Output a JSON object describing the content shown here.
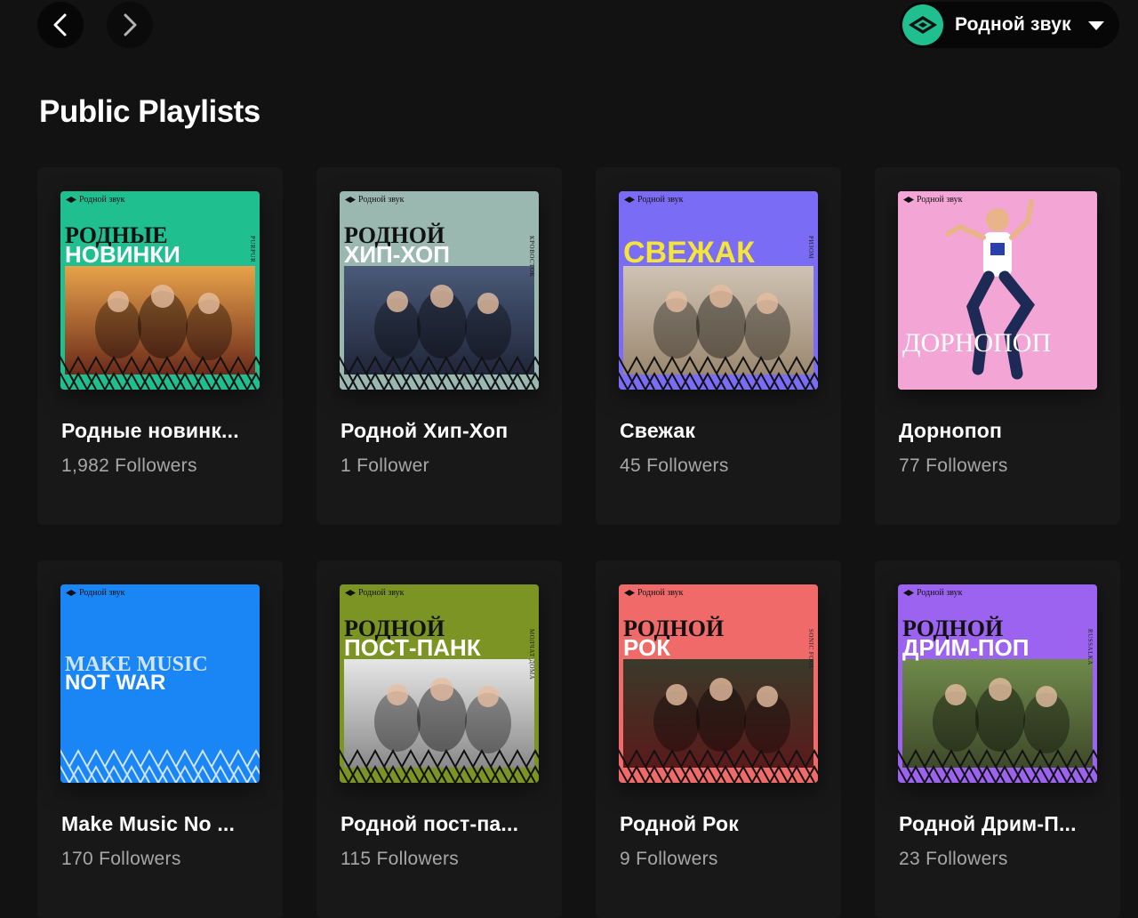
{
  "topbar": {
    "back_label": "Back",
    "forward_label": "Forward",
    "user_name": "Родной звук"
  },
  "section_title": "Public Playlists",
  "playlists": [
    {
      "title": "Родные новинк...",
      "followers": "1,982 Followers",
      "cover": {
        "brand": "Родной звук",
        "line1": "РОДНЫЕ",
        "line2": "НОВИНКИ",
        "side": "PURPUR",
        "bg": "#1fbf8f",
        "line1_color": "#111111",
        "line2_color": "#ffffff",
        "photo_top": "#e8a24a",
        "photo_bottom": "#6b2a1a",
        "fence_color": "#111111"
      }
    },
    {
      "title": "Родной Хип-Хоп",
      "followers": "1 Follower",
      "cover": {
        "brand": "Родной звук",
        "line1": "РОДНОЙ",
        "line2": "ХИП-ХОП",
        "side": "КРОВОСТОК",
        "bg": "#9ab8b0",
        "line1_color": "#111111",
        "line2_color": "#ffffff",
        "photo_top": "#4a5a78",
        "photo_bottom": "#20263a",
        "fence_color": "#111111"
      }
    },
    {
      "title": "Свежак",
      "followers": "45 Followers",
      "cover": {
        "brand": "Родной звук",
        "line1": "",
        "line2": "СВЕЖАК",
        "side": "РИЗОМ",
        "bg": "#7a6cf5",
        "line1_color": "#111111",
        "line2_color": "#f5e53a",
        "photo_top": "#cfc3b3",
        "photo_bottom": "#9b8870",
        "fence_color": "#111111"
      }
    },
    {
      "title": "Дорнопоп",
      "followers": "77 Followers",
      "cover": {
        "brand": "Родной звук",
        "line1": "",
        "line2": "ДОРНОПОП",
        "side": "",
        "bg": "#f3a6d6",
        "line1_color": "#111111",
        "line2_color": "#ffffff",
        "photo_top": "#f3a6d6",
        "photo_bottom": "#e98dc7",
        "fence_color": ""
      }
    },
    {
      "title": "Make Music No ...",
      "followers": "170 Followers",
      "cover": {
        "brand": "Родной звук",
        "line1": "MAKE MUSIC",
        "line2": "NOT WAR",
        "side": "",
        "bg": "#1a86f5",
        "line1_color": "#cfe4ff",
        "line2_color": "#ffffff",
        "photo_top": "#1a86f5",
        "photo_bottom": "#1a86f5",
        "fence_color": "#cfe4ff"
      }
    },
    {
      "title": "Родной пост-па...",
      "followers": "115 Followers",
      "cover": {
        "brand": "Родной звук",
        "line1": "РОДНОЙ",
        "line2": "ПОСТ-ПАНК",
        "side": "МОЛЧАТ ДОМА",
        "bg": "#7c9423",
        "line1_color": "#111111",
        "line2_color": "#ffffff",
        "photo_top": "#e6e6e6",
        "photo_bottom": "#8a8a8a",
        "fence_color": "#111111"
      }
    },
    {
      "title": "Родной Рок",
      "followers": "9 Followers",
      "cover": {
        "brand": "Родной звук",
        "line1": "РОДНОЙ",
        "line2": "РОК",
        "side": "SONIC FOOL",
        "bg": "#f06a6a",
        "line1_color": "#111111",
        "line2_color": "#ffffff",
        "photo_top": "#3a3a2a",
        "photo_bottom": "#5a1a1a",
        "fence_color": "#111111"
      }
    },
    {
      "title": "Родной Дрим-П...",
      "followers": "23 Followers",
      "cover": {
        "brand": "Родной звук",
        "line1": "РОДНОЙ",
        "line2": "ДРИМ-ПОП",
        "side": "RUSSALKA",
        "bg": "#9b63f0",
        "line1_color": "#111111",
        "line2_color": "#ffffff",
        "photo_top": "#6f8a4a",
        "photo_bottom": "#3e4a2a",
        "fence_color": "#111111"
      }
    }
  ]
}
